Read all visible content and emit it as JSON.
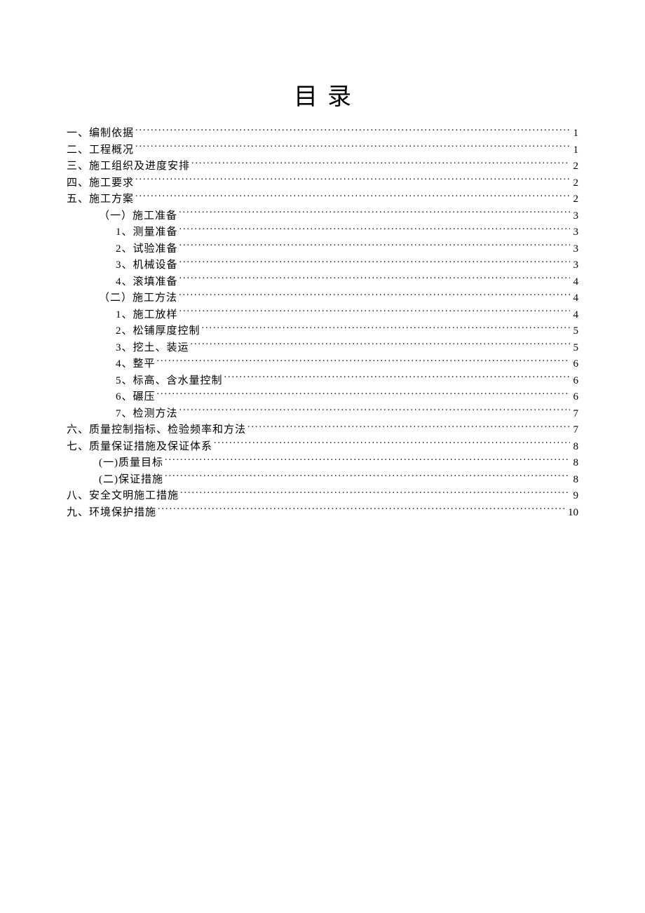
{
  "title": "目录",
  "entries": [
    {
      "label": "一、编制依据",
      "page": "1",
      "indent": 0
    },
    {
      "label": "二、工程概况",
      "page": "1",
      "indent": 0
    },
    {
      "label": "三、施工组织及进度安排",
      "page": "2",
      "indent": 0
    },
    {
      "label": "四、施工要求",
      "page": "2",
      "indent": 0
    },
    {
      "label": "五、施工方案",
      "page": "2",
      "indent": 0
    },
    {
      "label": "（一）施工准备",
      "page": "3",
      "indent": 1
    },
    {
      "label": "1、测量准备",
      "page": "3",
      "indent": 2
    },
    {
      "label": "2、试验准备",
      "page": "3",
      "indent": 2
    },
    {
      "label": "3、机械设备",
      "page": "3",
      "indent": 2
    },
    {
      "label": "4、滚填准备",
      "page": "4",
      "indent": 2
    },
    {
      "label": "（二）施工方法",
      "page": "4",
      "indent": 1
    },
    {
      "label": "1、施工放样",
      "page": "4",
      "indent": 2
    },
    {
      "label": "2、松铺厚度控制",
      "page": "5",
      "indent": 2
    },
    {
      "label": "3、挖土、装运",
      "page": "5",
      "indent": 2
    },
    {
      "label": "4、整平",
      "page": "6",
      "indent": 2
    },
    {
      "label": "5、标高、含水量控制",
      "page": "6",
      "indent": 2
    },
    {
      "label": "6、碾压",
      "page": "6",
      "indent": 2
    },
    {
      "label": "7、检测方法",
      "page": "7",
      "indent": 2
    },
    {
      "label": "六、质量控制指标、检验频率和方法",
      "page": "7",
      "indent": 0
    },
    {
      "label": "七、质量保证措施及保证体系",
      "page": "8",
      "indent": 0
    },
    {
      "label": "(一)质量目标",
      "page": "8",
      "indent": 1
    },
    {
      "label": "(二)保证措施",
      "page": "8",
      "indent": 1
    },
    {
      "label": "八、安全文明施工措施",
      "page": "9",
      "indent": 0
    },
    {
      "label": "九、环境保护措施",
      "page": "10",
      "indent": 0
    }
  ]
}
